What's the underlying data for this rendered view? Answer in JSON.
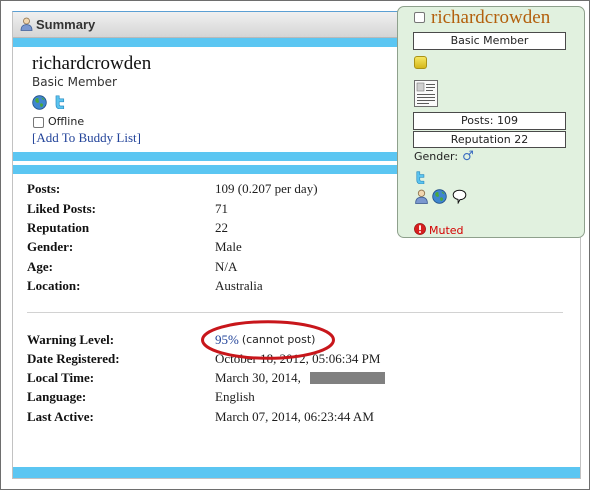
{
  "summary": {
    "title": "Summary",
    "icon": "user-icon"
  },
  "profile": {
    "username": "richardcrowden",
    "user_title": "Basic Member",
    "contact_icons": [
      "globe-icon",
      "twitter-icon"
    ],
    "status": "Offline",
    "add_buddy": "[Add To Buddy List]"
  },
  "stats": {
    "posts": {
      "label": "Posts:",
      "value": "109 (0.207 per day)"
    },
    "liked_posts": {
      "label": "Liked Posts:",
      "value": "71"
    },
    "reputation": {
      "label": "Reputation",
      "value": "22"
    },
    "gender": {
      "label": "Gender:",
      "value": "Male"
    },
    "age": {
      "label": "Age:",
      "value": "N/A"
    },
    "location": {
      "label": "Location:",
      "value": "Australia"
    }
  },
  "details": {
    "warning_level": {
      "label": "Warning Level:",
      "value": "95%",
      "note": "(cannot post)"
    },
    "date_registered": {
      "label": "Date Registered:",
      "value": "October 18, 2012, 05:06:34 PM"
    },
    "local_time": {
      "label": "Local Time:",
      "value": "March 30, 2014,"
    },
    "language": {
      "label": "Language:",
      "value": "English"
    },
    "last_active": {
      "label": "Last Active:",
      "value": "March 07, 2014, 06:23:44 AM"
    }
  },
  "popup": {
    "username": "richardcrowden",
    "user_title": "Basic Member",
    "posts": "Posts: 109",
    "reputation": "Reputation 22",
    "gender_label": "Gender:",
    "gender_symbol": "♂",
    "muted": "Muted",
    "icons": [
      "reputation-icon",
      "vcard-icon",
      "twitter-icon",
      "user-icon",
      "globe-icon",
      "speech-bubble-icon",
      "warning-icon"
    ]
  },
  "colors": {
    "strip_blue": "#5bc6f2",
    "link_blue": "#23449a",
    "popup_background": "#e1f1df",
    "popup_username": "#b3600d",
    "muted_red": "#d40000",
    "annotation_red": "#c8161b",
    "redaction_gray": "#808080"
  }
}
